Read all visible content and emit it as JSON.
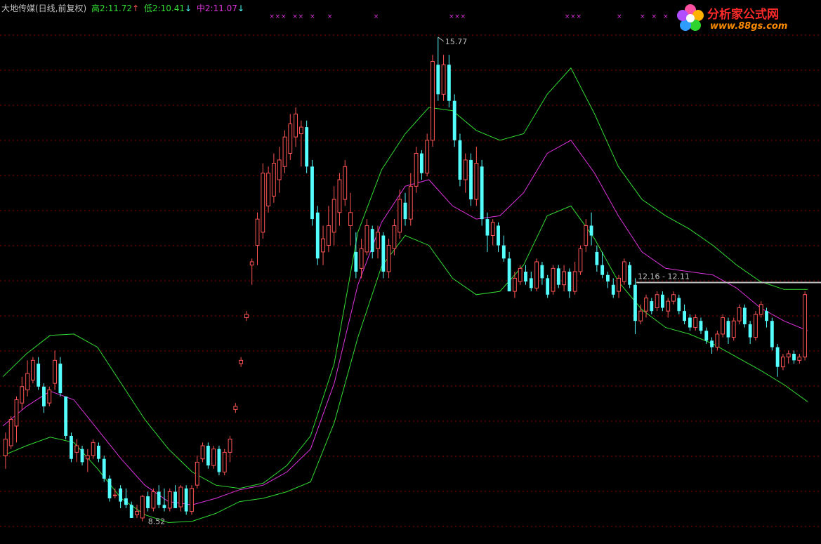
{
  "header": {
    "title": "大地传媒(日线,前复权)",
    "high_label": "高2",
    "high_value": "11.72",
    "low_label": "低2",
    "low_value": "10.41",
    "mid_label": "中2",
    "mid_value": "11.07",
    "up_arrow": "↑",
    "down_arrow": "↓"
  },
  "watermark": {
    "text": "分析家公式网",
    "url": "www.88gs.com"
  },
  "colors": {
    "background": "#000000",
    "up": "#ff5454",
    "down": "#54ffff",
    "band": "#33dd33",
    "mid": "#dd33dd",
    "grid": "#8b0000",
    "high_text": "#33dd33",
    "low_text": "#33dd33",
    "mid_text": "#dd33dd",
    "text": "#c0c0c0"
  },
  "chart_data": {
    "type": "candlestick",
    "y_range": [
      8.3,
      16.1
    ],
    "annotations": {
      "max": "15.77",
      "min": "8.52",
      "level": "12.16 - 12.11"
    },
    "band_upper": [
      10.6,
      10.95,
      11.23,
      11.25,
      11.05,
      10.5,
      9.95,
      9.5,
      9.15,
      8.95,
      8.9,
      8.98,
      9.25,
      9.7,
      10.8,
      12.8,
      13.75,
      14.3,
      14.7,
      14.65,
      14.35,
      14.2,
      14.3,
      14.9,
      15.3,
      14.6,
      13.8,
      13.3,
      13.05,
      12.85,
      12.6,
      12.3,
      12.05,
      11.93,
      11.93
    ],
    "band_mid": [
      9.85,
      10.15,
      10.38,
      10.25,
      9.8,
      9.35,
      8.95,
      8.7,
      8.65,
      8.75,
      8.88,
      8.95,
      9.15,
      9.5,
      10.5,
      12.0,
      12.95,
      13.5,
      13.6,
      13.2,
      13.0,
      13.05,
      13.4,
      14.0,
      14.2,
      13.7,
      13.05,
      12.5,
      12.25,
      12.2,
      12.15,
      11.95,
      11.65,
      11.45,
      11.3
    ],
    "band_lower": [
      9.4,
      9.55,
      9.68,
      9.6,
      9.2,
      8.75,
      8.5,
      8.38,
      8.4,
      8.52,
      8.7,
      8.75,
      8.85,
      9.0,
      9.9,
      11.2,
      12.28,
      12.75,
      12.6,
      12.1,
      11.85,
      11.9,
      12.3,
      13.05,
      13.2,
      12.7,
      12.05,
      11.62,
      11.35,
      11.25,
      11.1,
      10.9,
      10.7,
      10.48,
      10.22
    ],
    "candles": [
      [
        9.4,
        9.65,
        9.2,
        9.75
      ],
      [
        9.55,
        9.95,
        9.5,
        10.0
      ],
      [
        9.85,
        10.25,
        9.6,
        10.3
      ],
      [
        10.2,
        10.45,
        10.1,
        10.6
      ],
      [
        10.4,
        10.65,
        10.3,
        10.85
      ],
      [
        10.55,
        10.85,
        10.5,
        10.9
      ],
      [
        10.8,
        10.45,
        10.4,
        10.9
      ],
      [
        10.45,
        10.15,
        10.05,
        10.5
      ],
      [
        10.2,
        10.4,
        10.15,
        10.45
      ],
      [
        10.5,
        10.85,
        10.4,
        11.0
      ],
      [
        10.8,
        10.35,
        10.3,
        10.9
      ],
      [
        10.3,
        9.7,
        9.65,
        10.3
      ],
      [
        9.7,
        9.35,
        9.3,
        9.75
      ],
      [
        9.45,
        9.55,
        9.3,
        9.65
      ],
      [
        9.5,
        9.3,
        9.25,
        9.55
      ],
      [
        9.35,
        9.4,
        9.15,
        9.5
      ],
      [
        9.4,
        9.6,
        9.35,
        9.65
      ],
      [
        9.55,
        9.35,
        9.3,
        9.6
      ],
      [
        9.35,
        9.05,
        9.0,
        9.4
      ],
      [
        9.05,
        8.75,
        8.7,
        9.1
      ],
      [
        8.8,
        8.8,
        8.75,
        8.9
      ],
      [
        8.9,
        8.7,
        8.6,
        8.95
      ],
      [
        8.75,
        8.65,
        8.6,
        8.9
      ],
      [
        8.65,
        8.45,
        8.45,
        8.7
      ],
      [
        8.5,
        8.55,
        8.45,
        8.65
      ],
      [
        8.45,
        8.78,
        8.4,
        8.8
      ],
      [
        8.78,
        8.6,
        8.55,
        8.85
      ],
      [
        8.6,
        8.85,
        8.55,
        8.9
      ],
      [
        8.85,
        8.65,
        8.6,
        8.95
      ],
      [
        8.65,
        8.6,
        8.55,
        8.9
      ],
      [
        8.6,
        8.85,
        8.55,
        8.9
      ],
      [
        8.85,
        8.6,
        8.6,
        8.95
      ],
      [
        8.62,
        8.92,
        8.55,
        8.95
      ],
      [
        8.9,
        8.55,
        8.5,
        8.95
      ],
      [
        8.55,
        8.9,
        8.5,
        8.95
      ],
      [
        8.95,
        9.3,
        8.9,
        9.4
      ],
      [
        9.35,
        9.55,
        9.3,
        9.6
      ],
      [
        9.55,
        9.25,
        9.2,
        9.6
      ],
      [
        9.25,
        9.5,
        9.2,
        9.55
      ],
      [
        9.5,
        9.15,
        9.1,
        9.55
      ],
      [
        9.15,
        9.45,
        9.1,
        9.5
      ],
      [
        9.45,
        9.65,
        9.3,
        9.7
      ],
      [
        10.1,
        10.15,
        10.05,
        10.2
      ],
      [
        10.8,
        10.85,
        10.75,
        10.9
      ],
      [
        11.5,
        11.55,
        11.45,
        11.6
      ],
      [
        12.3,
        12.35,
        12.0,
        12.4
      ],
      [
        12.6,
        13.0,
        12.3,
        13.1
      ],
      [
        12.8,
        13.7,
        12.7,
        13.85
      ],
      [
        13.2,
        13.7,
        13.1,
        13.8
      ],
      [
        13.35,
        13.85,
        13.25,
        14.0
      ],
      [
        13.6,
        13.9,
        13.4,
        14.1
      ],
      [
        13.8,
        14.25,
        13.7,
        14.35
      ],
      [
        14.0,
        14.45,
        13.9,
        14.6
      ],
      [
        14.25,
        14.6,
        14.1,
        14.7
      ],
      [
        14.3,
        14.4,
        13.8,
        14.5
      ],
      [
        14.4,
        13.8,
        13.7,
        14.5
      ],
      [
        13.8,
        13.0,
        12.9,
        13.9
      ],
      [
        13.1,
        12.4,
        12.3,
        13.2
      ],
      [
        12.5,
        12.7,
        12.3,
        12.9
      ],
      [
        12.6,
        12.9,
        12.5,
        13.2
      ],
      [
        12.8,
        13.3,
        12.6,
        13.5
      ],
      [
        13.1,
        13.6,
        12.9,
        13.7
      ],
      [
        13.3,
        13.8,
        13.2,
        13.9
      ],
      [
        12.9,
        13.1,
        12.6,
        13.4
      ],
      [
        12.5,
        12.2,
        12.1,
        12.8
      ],
      [
        12.25,
        12.55,
        12.1,
        12.7
      ],
      [
        12.5,
        12.9,
        12.45,
        13.0
      ],
      [
        12.85,
        12.5,
        12.4,
        12.9
      ],
      [
        12.55,
        12.8,
        12.4,
        12.9
      ],
      [
        12.75,
        12.2,
        12.1,
        12.8
      ],
      [
        12.2,
        12.6,
        12.1,
        12.7
      ],
      [
        12.55,
        12.9,
        12.45,
        13.0
      ],
      [
        12.8,
        13.3,
        12.7,
        13.45
      ],
      [
        13.25,
        13.0,
        12.9,
        13.4
      ],
      [
        13.0,
        13.5,
        12.9,
        13.7
      ],
      [
        13.5,
        14.0,
        13.4,
        14.1
      ],
      [
        14.0,
        13.7,
        13.6,
        14.05
      ],
      [
        13.7,
        14.2,
        13.65,
        14.3
      ],
      [
        14.2,
        15.4,
        14.1,
        15.5
      ],
      [
        15.35,
        14.9,
        14.8,
        15.77
      ],
      [
        14.9,
        15.35,
        14.8,
        15.5
      ],
      [
        15.35,
        14.8,
        14.7,
        15.5
      ],
      [
        14.8,
        14.2,
        14.1,
        14.9
      ],
      [
        14.2,
        13.6,
        13.5,
        14.3
      ],
      [
        13.6,
        13.9,
        13.4,
        14.0
      ],
      [
        13.9,
        13.3,
        13.2,
        14.0
      ],
      [
        13.3,
        13.85,
        13.2,
        14.1
      ],
      [
        13.8,
        13.0,
        12.9,
        13.9
      ],
      [
        13.0,
        12.75,
        12.5,
        13.1
      ],
      [
        12.75,
        12.95,
        12.6,
        13.0
      ],
      [
        12.9,
        12.6,
        12.5,
        12.95
      ],
      [
        12.6,
        12.4,
        12.35,
        12.75
      ],
      [
        12.4,
        11.9,
        11.9,
        12.5
      ],
      [
        11.9,
        12.1,
        11.8,
        12.2
      ],
      [
        12.05,
        12.25,
        12.0,
        12.3
      ],
      [
        12.2,
        12.05,
        12.0,
        12.3
      ],
      [
        12.1,
        11.95,
        11.9,
        12.2
      ],
      [
        11.95,
        12.35,
        11.9,
        12.4
      ],
      [
        12.3,
        12.1,
        12.0,
        12.35
      ],
      [
        12.1,
        11.85,
        11.8,
        12.15
      ],
      [
        11.9,
        12.25,
        11.85,
        12.3
      ],
      [
        12.25,
        12.0,
        11.95,
        12.3
      ],
      [
        12.0,
        12.2,
        11.9,
        12.3
      ],
      [
        12.2,
        11.9,
        11.8,
        12.25
      ],
      [
        11.9,
        12.2,
        11.85,
        12.35
      ],
      [
        12.2,
        12.55,
        12.15,
        12.6
      ],
      [
        12.6,
        12.9,
        12.5,
        13.0
      ],
      [
        12.9,
        12.75,
        12.6,
        13.1
      ],
      [
        12.5,
        12.3,
        12.2,
        12.6
      ],
      [
        12.3,
        12.15,
        12.1,
        12.5
      ],
      [
        12.15,
        12.05,
        11.95,
        12.2
      ],
      [
        12.0,
        11.85,
        11.8,
        12.1
      ],
      [
        11.9,
        12.1,
        11.8,
        12.15
      ],
      [
        12.05,
        12.35,
        12.0,
        12.4
      ],
      [
        12.3,
        12.0,
        11.95,
        12.35
      ],
      [
        12.0,
        11.45,
        11.25,
        12.1
      ],
      [
        11.45,
        11.6,
        11.4,
        11.7
      ],
      [
        11.6,
        11.8,
        11.5,
        11.85
      ],
      [
        11.75,
        11.6,
        11.55,
        11.8
      ],
      [
        11.65,
        11.85,
        11.6,
        11.9
      ],
      [
        11.85,
        11.65,
        11.6,
        11.9
      ],
      [
        11.6,
        11.75,
        11.5,
        11.8
      ],
      [
        11.75,
        11.85,
        11.7,
        11.9
      ],
      [
        11.8,
        11.6,
        11.55,
        11.85
      ],
      [
        11.6,
        11.45,
        11.4,
        11.7
      ],
      [
        11.5,
        11.35,
        11.3,
        11.55
      ],
      [
        11.35,
        11.5,
        11.3,
        11.55
      ],
      [
        11.45,
        11.3,
        11.25,
        11.5
      ],
      [
        11.3,
        11.15,
        11.1,
        11.35
      ],
      [
        11.15,
        11.05,
        10.95,
        11.2
      ],
      [
        11.05,
        11.25,
        11.0,
        11.3
      ],
      [
        11.25,
        11.5,
        11.2,
        11.55
      ],
      [
        11.45,
        11.2,
        11.1,
        11.5
      ],
      [
        11.2,
        11.45,
        11.15,
        11.5
      ],
      [
        11.45,
        11.65,
        11.4,
        11.7
      ],
      [
        11.65,
        11.4,
        11.35,
        11.7
      ],
      [
        11.4,
        11.2,
        11.1,
        11.45
      ],
      [
        11.2,
        11.55,
        11.15,
        11.6
      ],
      [
        11.55,
        11.7,
        11.5,
        11.75
      ],
      [
        11.6,
        11.45,
        11.35,
        11.65
      ],
      [
        11.45,
        11.05,
        11.0,
        11.5
      ],
      [
        11.05,
        10.75,
        10.6,
        11.1
      ],
      [
        10.75,
        10.9,
        10.7,
        10.95
      ],
      [
        10.9,
        10.95,
        10.8,
        11.0
      ],
      [
        10.95,
        10.85,
        10.8,
        11.0
      ],
      [
        10.85,
        10.9,
        10.8,
        10.95
      ],
      [
        10.9,
        11.85,
        10.85,
        11.9
      ]
    ]
  }
}
